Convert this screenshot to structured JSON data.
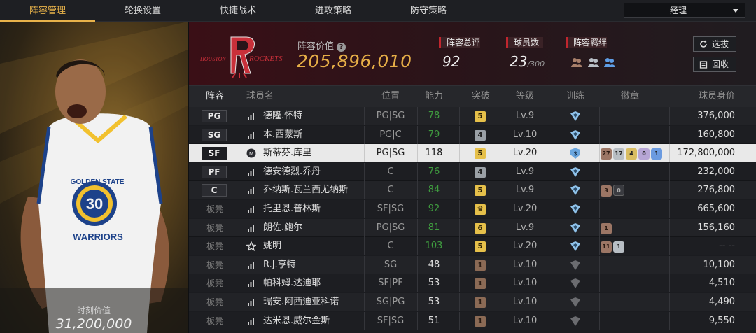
{
  "nav": {
    "tabs": [
      {
        "label": "阵容管理",
        "active": true
      },
      {
        "label": "轮换设置",
        "active": false
      },
      {
        "label": "快捷战术",
        "active": false
      },
      {
        "label": "进攻策略",
        "active": false
      },
      {
        "label": "防守策略",
        "active": false
      }
    ],
    "role_select": "经理"
  },
  "player_panel": {
    "value_label": "时刻价值",
    "value": "31,200,000",
    "jersey_team": "GOLDEN STATE",
    "jersey_number": "30",
    "jersey_name": "WARRIORS"
  },
  "team_header": {
    "logo_text_left": "HOUSTON",
    "logo_text_right": "ROCKETS",
    "lineup_value_label": "阵容价值",
    "help_icon": "?",
    "lineup_value": "205,896,010",
    "rating_label": "阵容总评",
    "rating_value": "92",
    "player_count_label": "球员数",
    "player_count": "23",
    "player_capacity": "/300",
    "chemistry_label": "阵容羁绊",
    "select_button": "选拔",
    "recycle_button": "回收"
  },
  "colors": {
    "accent": "#e8b24a",
    "green_ability": "#3f9c3f",
    "red_marker": "#c0262e"
  },
  "table": {
    "headers": {
      "lineup": "阵容",
      "name": "球员名",
      "position": "位置",
      "ability": "能力",
      "breakthrough": "突破",
      "level": "等级",
      "training": "训练",
      "badges": "徽章",
      "salary": "球员身价"
    },
    "rows": [
      {
        "slot": "PG",
        "starter": true,
        "icon": "bars-icon",
        "name": "德隆.怀特",
        "position": "PG|SG",
        "ability": "78",
        "green": true,
        "bt": "5",
        "bt_style": "gold",
        "level": "Lv.9",
        "train": "shield-icon",
        "badges": [],
        "salary": "376,000"
      },
      {
        "slot": "SG",
        "starter": true,
        "icon": "bars-icon",
        "name": "本.西蒙斯",
        "position": "PG|C",
        "ability": "79",
        "green": true,
        "bt": "4",
        "bt_style": "gray",
        "level": "Lv.10",
        "train": "shield-icon",
        "badges": [],
        "salary": "160,800"
      },
      {
        "slot": "SF",
        "starter": true,
        "selected": true,
        "icon": "moment-icon",
        "name": "斯蒂芬.库里",
        "position": "PG|SG",
        "ability": "118",
        "green": false,
        "bt": "5",
        "bt_style": "gold",
        "level": "Lv.20",
        "train": "3",
        "badges": [
          {
            "t": "27",
            "s": "bronze"
          },
          {
            "t": "17",
            "s": "silver"
          },
          {
            "t": "4",
            "s": "gold"
          },
          {
            "t": "0",
            "s": "purple"
          },
          {
            "t": "1",
            "s": "blue"
          }
        ],
        "salary": "172,800,000"
      },
      {
        "slot": "PF",
        "starter": true,
        "icon": "bars-icon",
        "name": "德安德烈.乔丹",
        "position": "C",
        "ability": "76",
        "green": true,
        "bt": "4",
        "bt_style": "gray",
        "level": "Lv.9",
        "train": "shield-icon",
        "badges": [],
        "salary": "232,000"
      },
      {
        "slot": "C",
        "starter": true,
        "icon": "bars-icon",
        "name": "乔纳斯.瓦兰西尤纳斯",
        "position": "C",
        "ability": "84",
        "green": true,
        "bt": "5",
        "bt_style": "gold",
        "level": "Lv.9",
        "train": "shield-icon",
        "badges": [
          {
            "t": "3",
            "s": "bronze"
          },
          {
            "t": "0",
            "s": "dark"
          }
        ],
        "salary": "276,800"
      },
      {
        "slot": "板凳",
        "starter": false,
        "icon": "bars-icon",
        "name": "托里恩.普林斯",
        "position": "SF|SG",
        "ability": "92",
        "green": true,
        "bt": "♛",
        "bt_style": "gold",
        "level": "Lv.20",
        "train": "shield-icon",
        "badges": [],
        "salary": "665,600"
      },
      {
        "slot": "板凳",
        "starter": false,
        "icon": "bars-icon",
        "name": "朗佐.鲍尔",
        "position": "PG|SG",
        "ability": "81",
        "green": true,
        "bt": "6",
        "bt_style": "gold",
        "level": "Lv.9",
        "train": "shield-icon",
        "badges": [
          {
            "t": "1",
            "s": "bronze"
          }
        ],
        "salary": "156,160"
      },
      {
        "slot": "板凳",
        "starter": false,
        "icon": "star-icon",
        "name": "姚明",
        "position": "C",
        "ability": "103",
        "green": true,
        "bt": "5",
        "bt_style": "gold",
        "level": "Lv.20",
        "train": "shield-icon",
        "badges": [
          {
            "t": "11",
            "s": "bronze"
          },
          {
            "t": "1",
            "s": "silver"
          }
        ],
        "salary": "-- --"
      },
      {
        "slot": "板凳",
        "starter": false,
        "icon": "bars-icon",
        "name": "R.J.亨特",
        "position": "SG",
        "ability": "48",
        "green": false,
        "bt": "1",
        "bt_style": "bronze",
        "level": "Lv.10",
        "train": "shield-dim-icon",
        "badges": [],
        "salary": "10,100"
      },
      {
        "slot": "板凳",
        "starter": false,
        "icon": "bars-icon",
        "name": "帕科姆.达迪耶",
        "position": "SF|PF",
        "ability": "53",
        "green": false,
        "bt": "1",
        "bt_style": "bronze",
        "level": "Lv.10",
        "train": "shield-dim-icon",
        "badges": [],
        "salary": "4,510"
      },
      {
        "slot": "板凳",
        "starter": false,
        "icon": "bars-icon",
        "name": "瑞安.阿西迪亚科诺",
        "position": "SG|PG",
        "ability": "53",
        "green": false,
        "bt": "1",
        "bt_style": "bronze",
        "level": "Lv.10",
        "train": "shield-dim-icon",
        "badges": [],
        "salary": "4,490"
      },
      {
        "slot": "板凳",
        "starter": false,
        "icon": "bars-icon",
        "name": "达米恩.威尔金斯",
        "position": "SF|SG",
        "ability": "51",
        "green": false,
        "bt": "1",
        "bt_style": "bronze",
        "level": "Lv.10",
        "train": "shield-dim-icon",
        "badges": [],
        "salary": "9,550"
      }
    ]
  }
}
